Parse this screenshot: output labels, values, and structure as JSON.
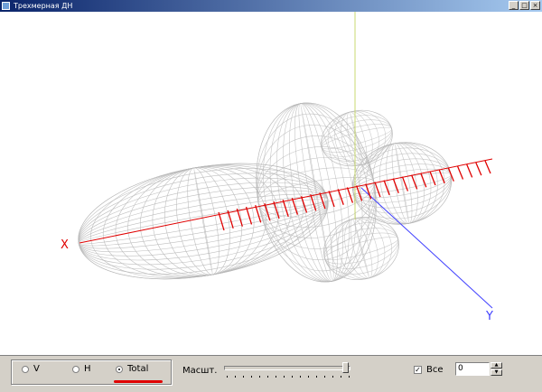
{
  "window": {
    "title": "Трехмерная ДН",
    "buttons": {
      "minimize": "_",
      "maximize": "□",
      "close": "×"
    }
  },
  "scene": {
    "axis_x_label": "X",
    "axis_y_label": "Y",
    "colors": {
      "pattern_mesh": "#b8b8b8",
      "antenna": "#e00000",
      "axis_x": "#e00000",
      "axis_y": "#4040ff",
      "axis_z": "#c8d870"
    }
  },
  "toolbar": {
    "polarization": {
      "options": [
        "V",
        "H",
        "Total"
      ],
      "selected": "Total"
    },
    "scale_label": "Масшт.",
    "scale_value": 0.95,
    "all_label": "Все",
    "all_checked": true,
    "spin_value": "0"
  }
}
